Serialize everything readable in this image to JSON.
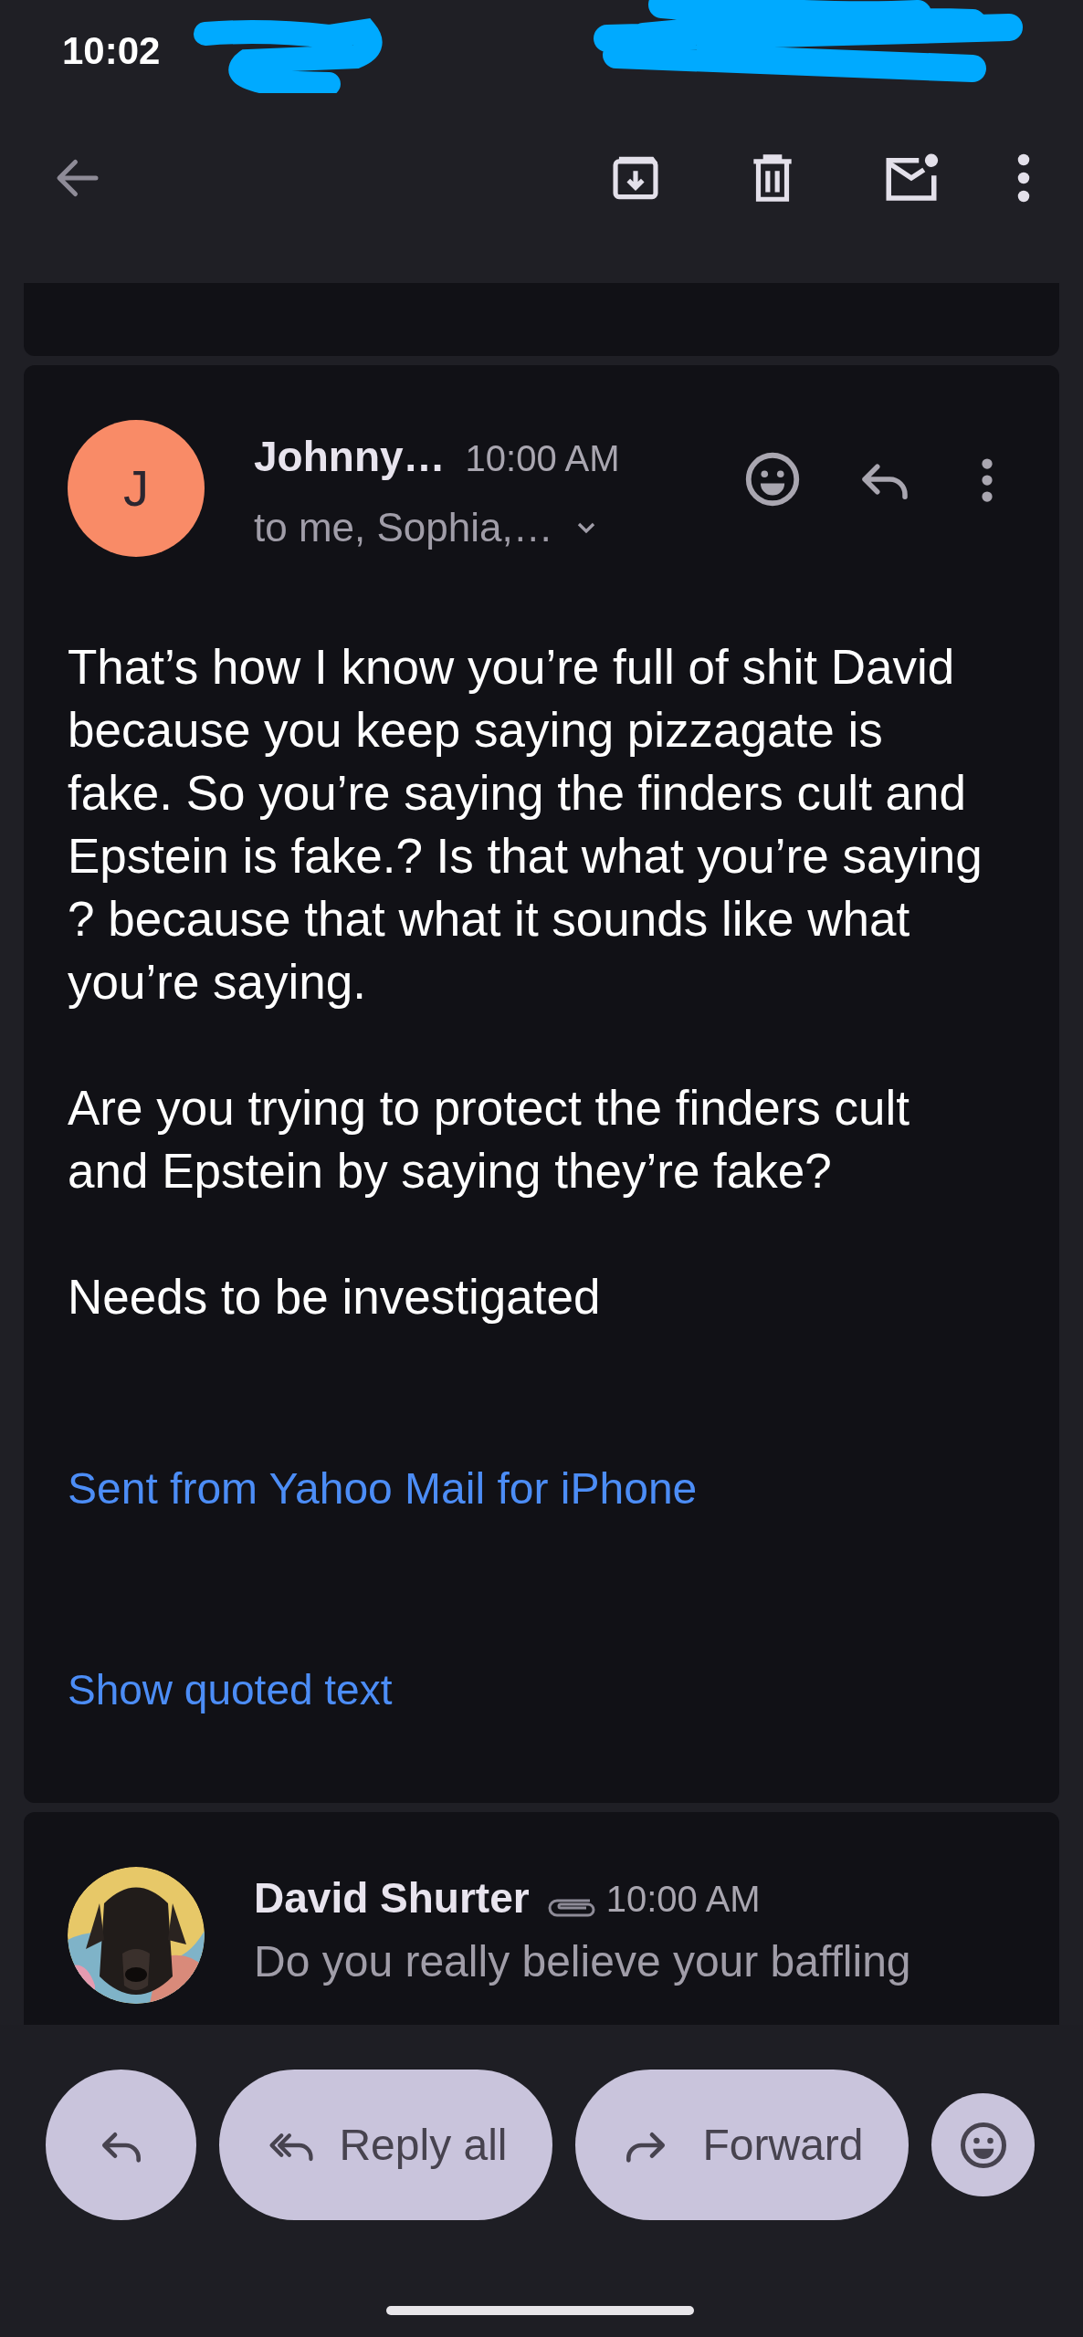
{
  "status_bar": {
    "time": "10:02"
  },
  "message": {
    "sender": "Johnny…",
    "avatar_letter": "J",
    "time": "10:00 AM",
    "recipients": "to me, Sophia,…",
    "body": [
      "That’s how I know you’re full of shit David because you keep saying pizzagate is fake. So you’re saying the finders cult and Epstein is fake.? Is that what you’re saying ? because that what it sounds like what you’re saying.",
      "Are you trying to protect the finders cult and Epstein by saying they’re fake?",
      "Needs to be investigated"
    ],
    "signature_link": "Sent from Yahoo Mail for iPhone",
    "quoted_link": "Show quoted text"
  },
  "next_message": {
    "sender": "David Shurter",
    "has_attachment": true,
    "time": "10:00 AM",
    "preview": [
      "Do you really believe your baffling"
    ]
  },
  "actions": [
    {
      "kind": "reply"
    },
    {
      "kind": "reply_all",
      "label": "Reply all"
    },
    {
      "kind": "forward",
      "label": "Forward"
    },
    {
      "kind": "react"
    }
  ]
}
